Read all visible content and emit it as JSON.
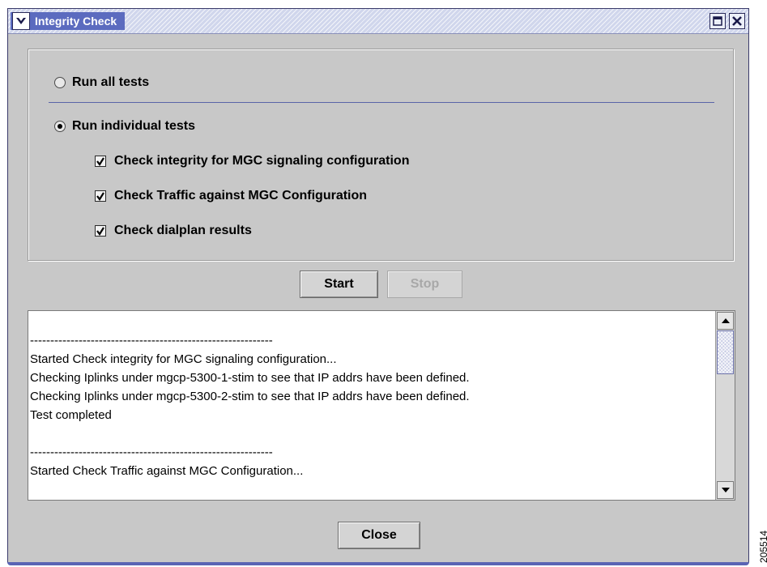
{
  "window": {
    "title": "Integrity Check"
  },
  "options": {
    "run_all": {
      "label": "Run all tests",
      "selected": false
    },
    "run_individual": {
      "label": "Run individual tests",
      "selected": true
    },
    "tests": [
      {
        "label": "Check integrity for MGC signaling configuration",
        "checked": true
      },
      {
        "label": "Check Traffic against MGC Configuration",
        "checked": true
      },
      {
        "label": "Check dialplan results",
        "checked": true
      }
    ]
  },
  "buttons": {
    "start_label": "Start",
    "stop_label": "Stop",
    "close_label": "Close"
  },
  "log": {
    "lines": [
      "",
      "------------------------------------------------------------",
      "Started Check integrity for MGC signaling configuration...",
      "Checking Iplinks under mgcp-5300-1-stim to see that IP addrs have been defined.",
      "Checking Iplinks under mgcp-5300-2-stim to see that IP addrs have been defined.",
      "Test completed",
      "",
      "------------------------------------------------------------",
      "Started Check Traffic against MGC Configuration..."
    ]
  },
  "figure_id": "205514",
  "colors": {
    "title_highlight": "#5b6bbf",
    "window_bg": "#c8c8c8",
    "separator": "#5a64a8"
  }
}
